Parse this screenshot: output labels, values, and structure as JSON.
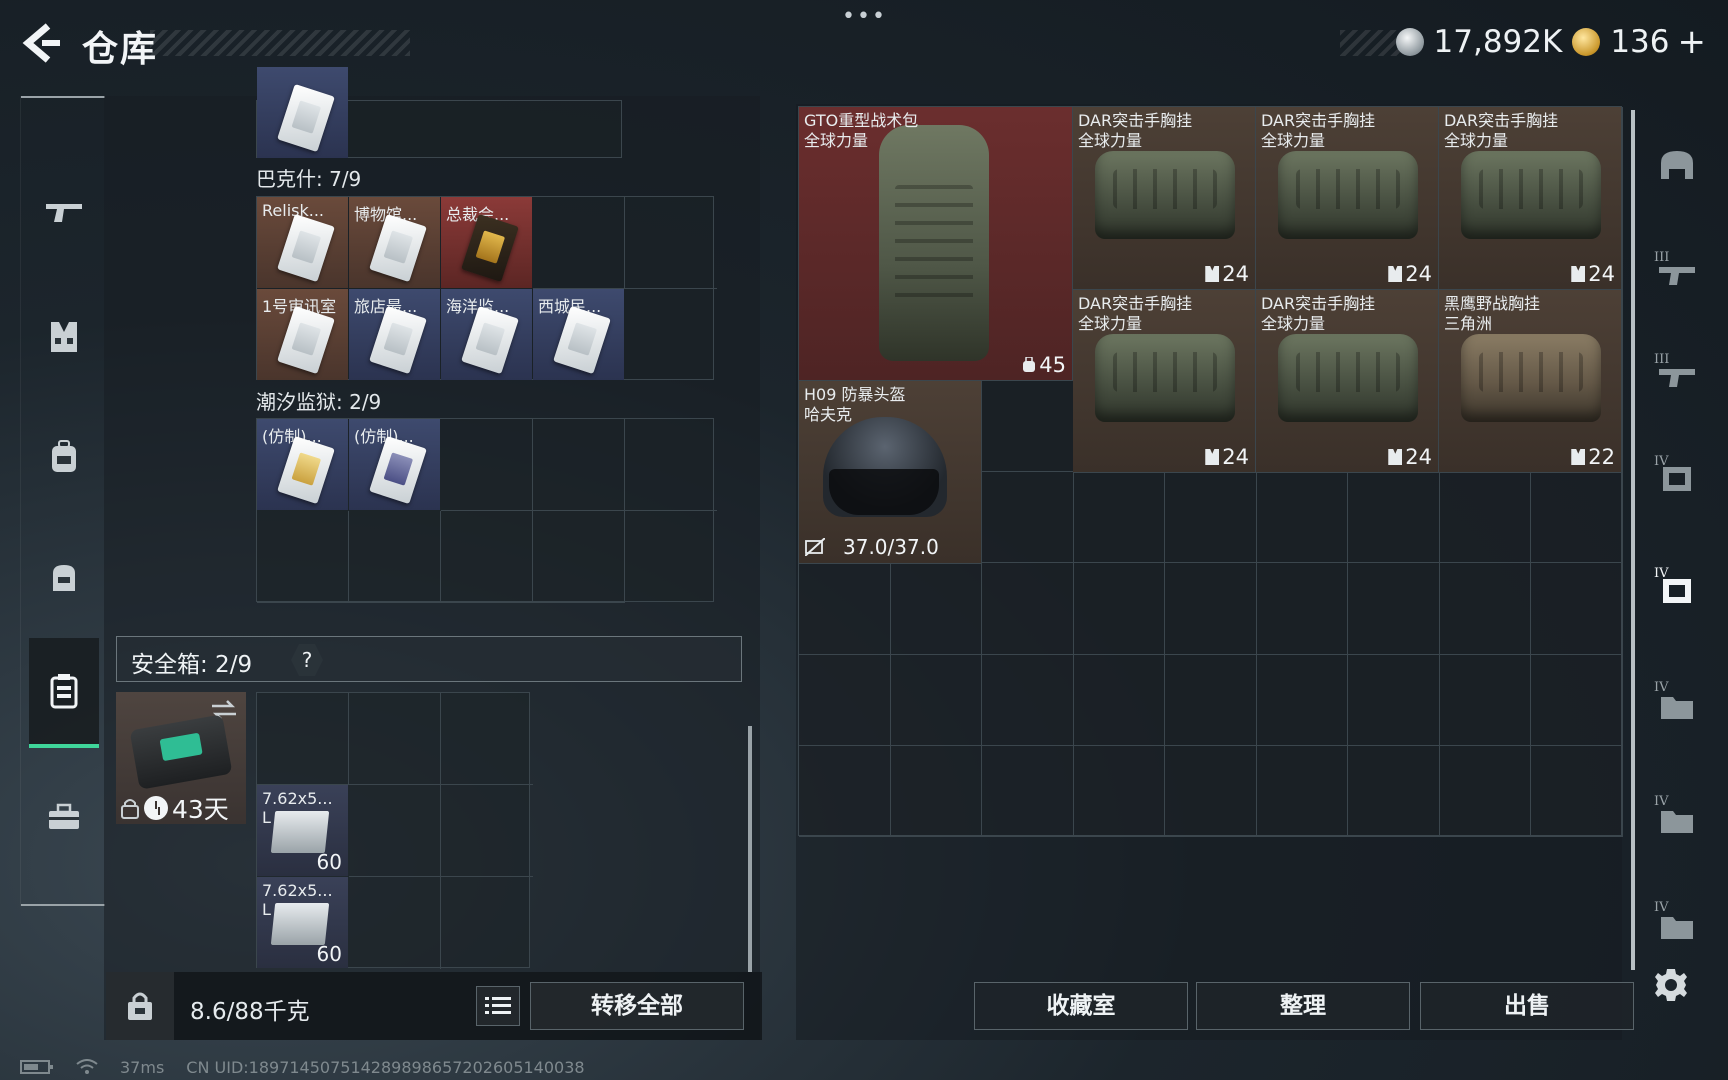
{
  "header": {
    "title": "仓库",
    "more": "•••",
    "currency": [
      {
        "icon": "silver-coin-icon",
        "value": "17,892K"
      },
      {
        "icon": "gold-coin-icon",
        "value": "136"
      }
    ],
    "add_label": "+"
  },
  "sidebar": {
    "items": [
      {
        "icon": "rifle-icon"
      },
      {
        "icon": "vest-icon"
      },
      {
        "icon": "backpack-icon"
      },
      {
        "icon": "bag-icon"
      },
      {
        "icon": "storage-icon",
        "active": true
      },
      {
        "icon": "toolbox-icon"
      }
    ]
  },
  "keys": {
    "sections": [
      {
        "title": "巴克什: 7/9",
        "cards": [
          {
            "label": "Relisk...",
            "color": "brown"
          },
          {
            "label": "博物馆...",
            "color": "brown"
          },
          {
            "label": "总裁会...",
            "color": "red"
          },
          {
            "label": "1号审讯室",
            "color": "brown"
          },
          {
            "label": "旅店最...",
            "color": "blue"
          },
          {
            "label": "海洋监...",
            "color": "blue"
          },
          {
            "label": "西城民...",
            "color": "blue"
          }
        ]
      },
      {
        "title": "潮汐监狱: 2/9",
        "cards": [
          {
            "label": "(仿制)...",
            "color": "blue"
          },
          {
            "label": "(仿制)...",
            "color": "blue"
          }
        ]
      }
    ]
  },
  "safebox": {
    "label": "安全箱: 2/9",
    "help": "?",
    "timer": "43天",
    "ammo": [
      {
        "label_line1": "7.62x5...",
        "label_line2": "L",
        "count": "60"
      },
      {
        "label_line1": "7.62x5...",
        "label_line2": "L",
        "count": "60"
      }
    ]
  },
  "bottom_left": {
    "weight": "8.6/88千克",
    "transfer_all": "转移全部"
  },
  "stash": {
    "items": [
      {
        "name": "GTO重型战术包",
        "sub": "全球力量",
        "qty": "45",
        "type": "backpack"
      },
      {
        "name": "DAR突击手胸挂",
        "sub": "全球力量",
        "qty": "24",
        "type": "vest"
      },
      {
        "name": "DAR突击手胸挂",
        "sub": "全球力量",
        "qty": "24",
        "type": "vest"
      },
      {
        "name": "DAR突击手胸挂",
        "sub": "全球力量",
        "qty": "24",
        "type": "vest"
      },
      {
        "name": "DAR突击手胸挂",
        "sub": "全球力量",
        "qty": "24",
        "type": "vest"
      },
      {
        "name": "DAR突击手胸挂",
        "sub": "全球力量",
        "qty": "24",
        "type": "vest"
      },
      {
        "name": "黑鹰野战胸挂",
        "sub": "三角洲",
        "qty": "22",
        "type": "vest-tan"
      },
      {
        "name": "H09 防暴头盔",
        "sub": "哈夫克",
        "durability": "37.0/37.0",
        "type": "helmet"
      }
    ]
  },
  "actions": {
    "collection": "收藏室",
    "organize": "整理",
    "sell": "出售"
  },
  "right_sidebar": {
    "tiers": [
      "",
      "III",
      "III",
      "IV",
      "IV",
      "IV",
      "IV",
      "IV"
    ]
  },
  "status": {
    "ping": "37ms",
    "uid": "CN UID:18971450751428989865720260514003​8"
  }
}
